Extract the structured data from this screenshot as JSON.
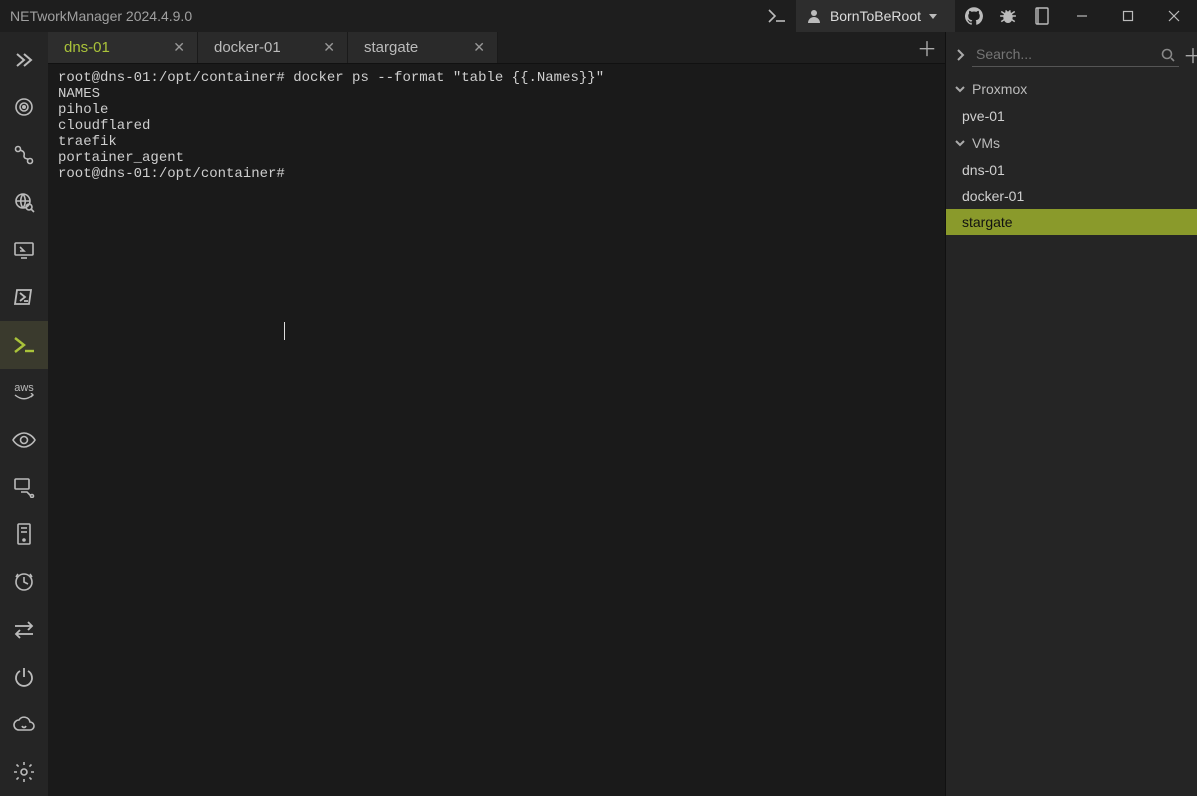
{
  "window": {
    "title": "NETworkManager 2024.4.9.0",
    "profile_name": "BornToBeRoot"
  },
  "tabs": [
    {
      "label": "dns-01",
      "active": true
    },
    {
      "label": "docker-01",
      "active": false
    },
    {
      "label": "stargate",
      "active": false
    }
  ],
  "terminal": {
    "lines": [
      "root@dns-01:/opt/container# docker ps --format \"table {{.Names}}\"",
      "NAMES",
      "pihole",
      "cloudflared",
      "traefik",
      "portainer_agent",
      "root@dns-01:/opt/container#"
    ]
  },
  "right": {
    "search_placeholder": "Search...",
    "groups": [
      {
        "label": "Proxmox",
        "items": [
          {
            "label": "pve-01",
            "selected": false
          }
        ]
      },
      {
        "label": "VMs",
        "items": [
          {
            "label": "dns-01",
            "selected": false
          },
          {
            "label": "docker-01",
            "selected": false
          },
          {
            "label": "stargate",
            "selected": true
          }
        ]
      }
    ]
  },
  "tool_icons": [
    "expand-icon",
    "target-icon",
    "route-icon",
    "globe-search-icon",
    "display-icon",
    "powershell-icon",
    "terminal-icon",
    "aws-icon",
    "eye-icon",
    "port-forward-icon",
    "server-icon",
    "clock-icon",
    "swap-icon",
    "power-icon",
    "cloud-icon"
  ],
  "active_tool_index": 6
}
